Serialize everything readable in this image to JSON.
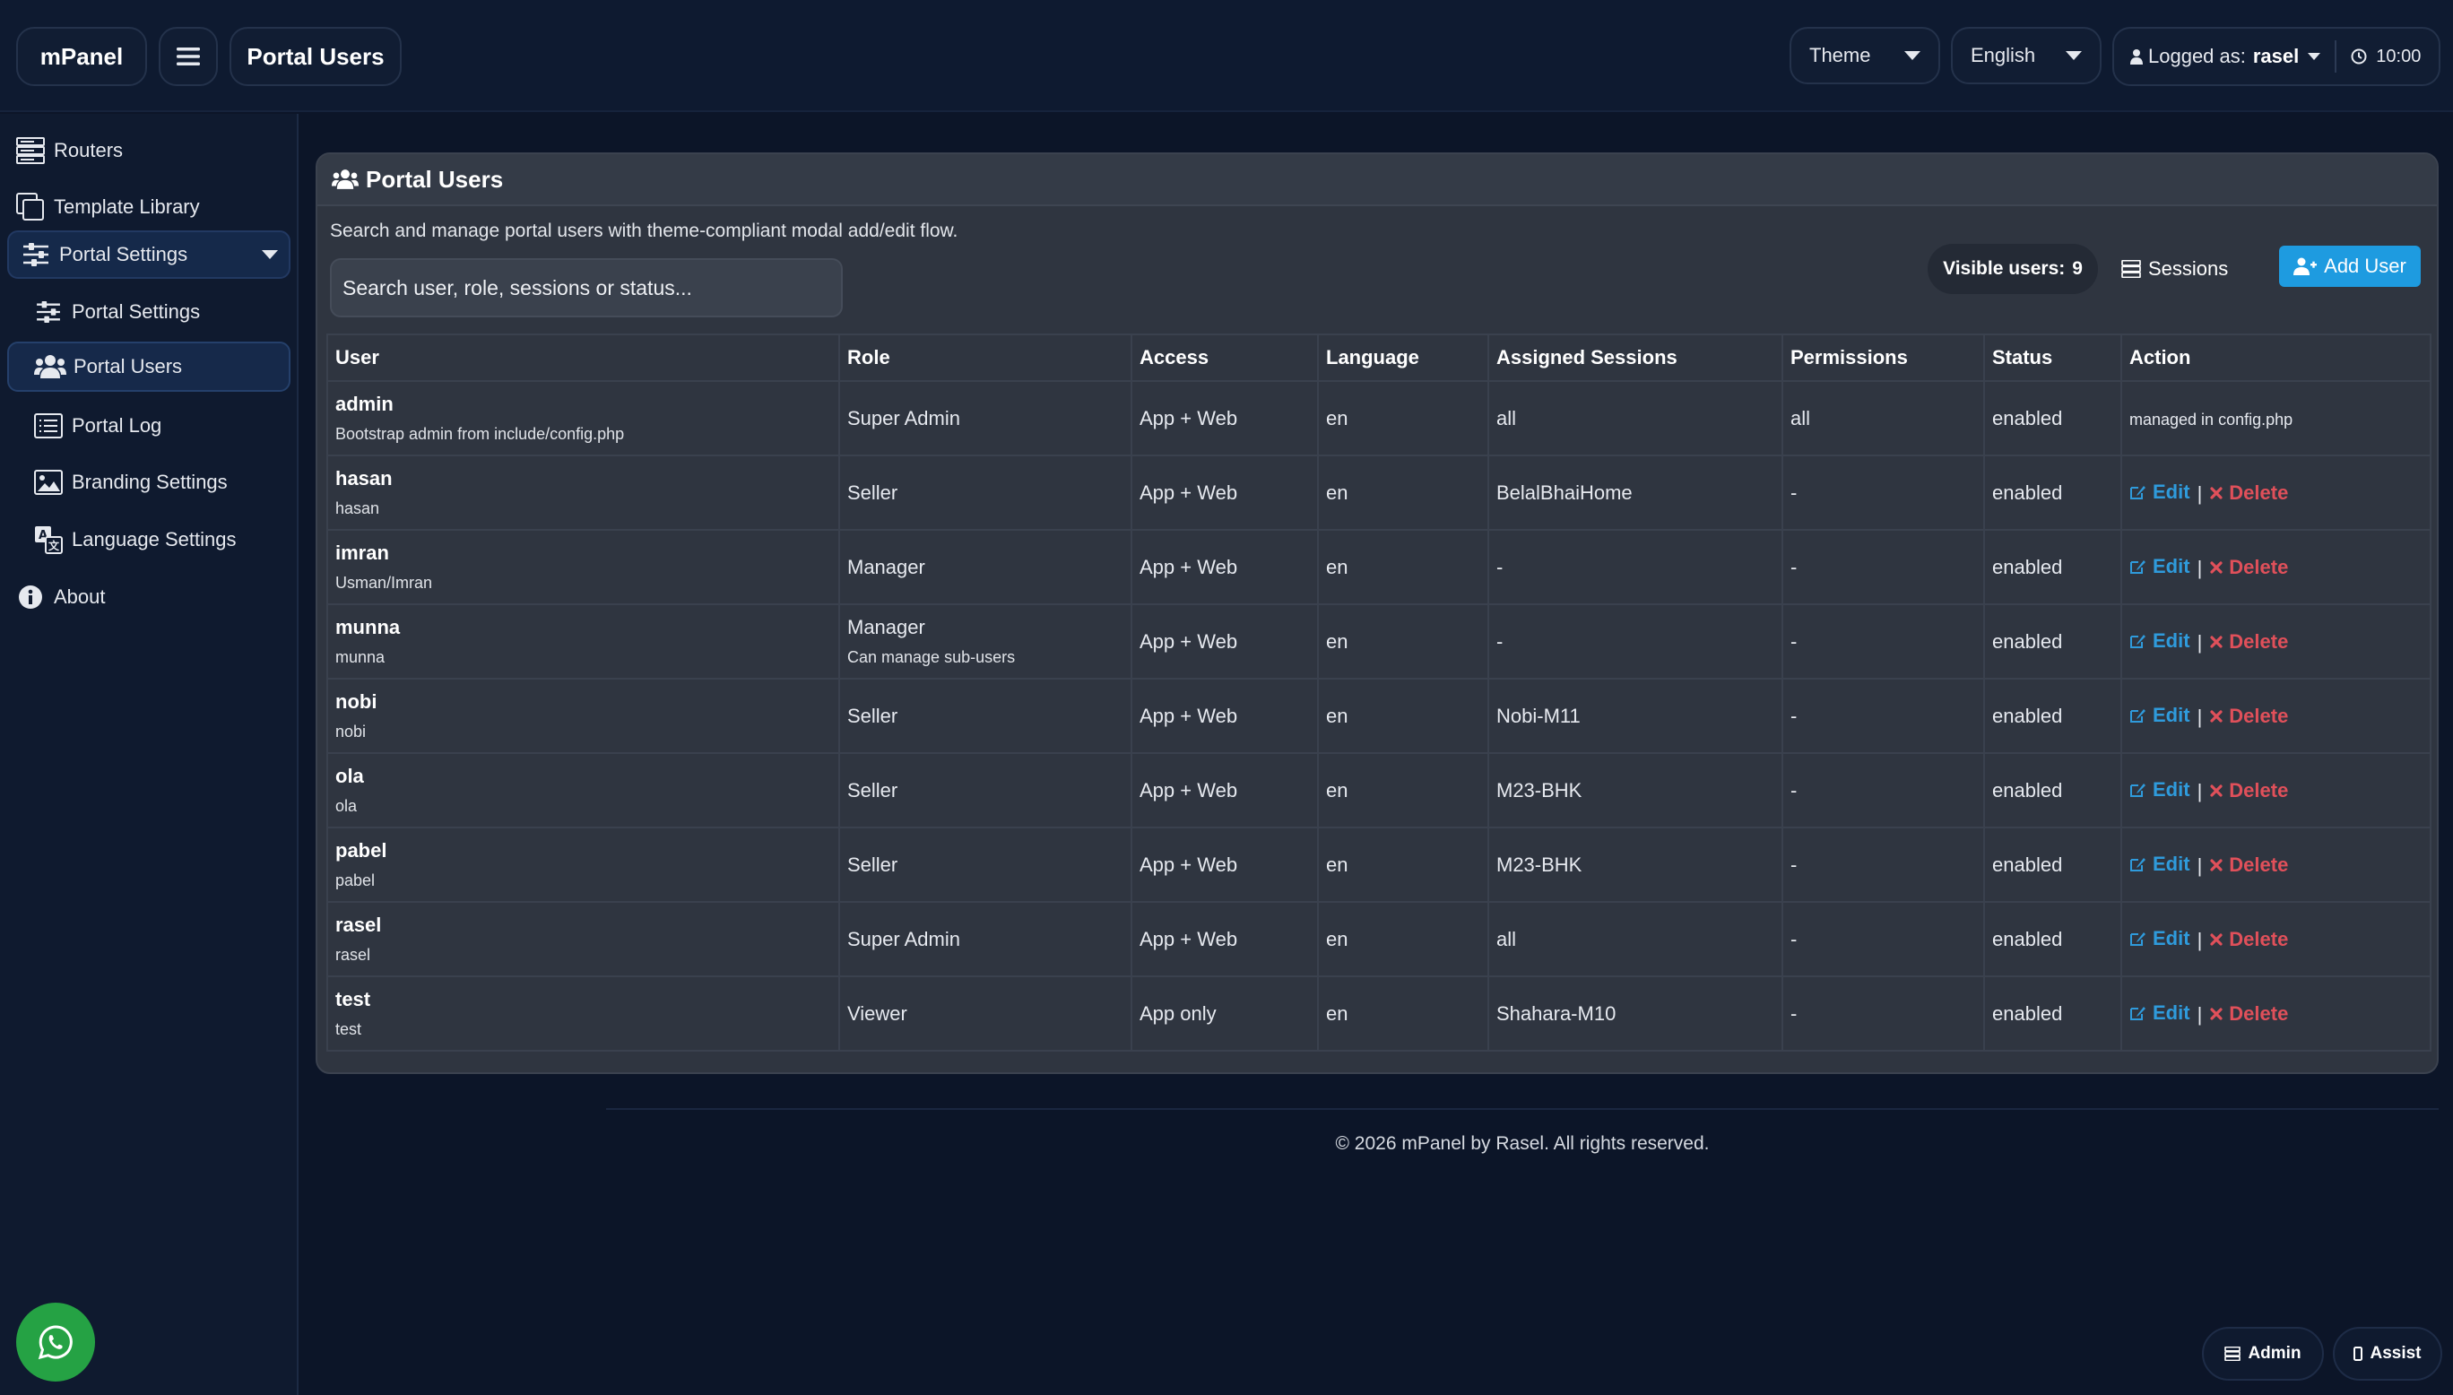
{
  "topbar": {
    "brand": "mPanel",
    "page_title": "Portal Users",
    "theme_label": "Theme",
    "language_label": "English",
    "logged_as_label": "Logged as:",
    "username": "rasel",
    "time": "10:00"
  },
  "sidebar": {
    "items": [
      {
        "label": "Routers",
        "icon": "server-icon"
      },
      {
        "label": "Template Library",
        "icon": "copy-icon"
      },
      {
        "label": "Portal Settings",
        "icon": "sliders-icon"
      },
      {
        "label": "Portal Settings",
        "icon": "sliders-icon"
      },
      {
        "label": "Portal Users",
        "icon": "users-icon"
      },
      {
        "label": "Portal Log",
        "icon": "list-icon"
      },
      {
        "label": "Branding Settings",
        "icon": "image-icon"
      },
      {
        "label": "Language Settings",
        "icon": "language-icon"
      },
      {
        "label": "About",
        "icon": "info-icon"
      }
    ]
  },
  "card": {
    "title": "Portal Users",
    "description": "Search and manage portal users with theme-compliant modal add/edit flow.",
    "search_placeholder": "Search user, role, sessions or status...",
    "visible_label": "Visible users:",
    "visible_count": "9",
    "sessions_label": "Sessions",
    "add_user_label": "Add User"
  },
  "table": {
    "headers": [
      "User",
      "Role",
      "Access",
      "Language",
      "Assigned Sessions",
      "Permissions",
      "Status",
      "Action"
    ],
    "edit_label": "Edit",
    "delete_label": "Delete",
    "separator": "|",
    "rows": [
      {
        "name": "admin",
        "sub": "Bootstrap admin from include/config.php",
        "role": "Super Admin",
        "role_note": "",
        "access": "App + Web",
        "language": "en",
        "sessions": "all",
        "permissions": "all",
        "status": "enabled",
        "action_note": "managed in config.php"
      },
      {
        "name": "hasan",
        "sub": "hasan",
        "role": "Seller",
        "role_note": "",
        "access": "App + Web",
        "language": "en",
        "sessions": "BelalBhaiHome",
        "permissions": "-",
        "status": "enabled",
        "action_note": ""
      },
      {
        "name": "imran",
        "sub": "Usman/Imran",
        "role": "Manager",
        "role_note": "",
        "access": "App + Web",
        "language": "en",
        "sessions": "-",
        "permissions": "-",
        "status": "enabled",
        "action_note": ""
      },
      {
        "name": "munna",
        "sub": "munna",
        "role": "Manager",
        "role_note": "Can manage sub-users",
        "access": "App + Web",
        "language": "en",
        "sessions": "-",
        "permissions": "-",
        "status": "enabled",
        "action_note": ""
      },
      {
        "name": "nobi",
        "sub": "nobi",
        "role": "Seller",
        "role_note": "",
        "access": "App + Web",
        "language": "en",
        "sessions": "Nobi-M11",
        "permissions": "-",
        "status": "enabled",
        "action_note": ""
      },
      {
        "name": "ola",
        "sub": "ola",
        "role": "Seller",
        "role_note": "",
        "access": "App + Web",
        "language": "en",
        "sessions": "M23-BHK",
        "permissions": "-",
        "status": "enabled",
        "action_note": ""
      },
      {
        "name": "pabel",
        "sub": "pabel",
        "role": "Seller",
        "role_note": "",
        "access": "App + Web",
        "language": "en",
        "sessions": "M23-BHK",
        "permissions": "-",
        "status": "enabled",
        "action_note": ""
      },
      {
        "name": "rasel",
        "sub": "rasel",
        "role": "Super Admin",
        "role_note": "",
        "access": "App + Web",
        "language": "en",
        "sessions": "all",
        "permissions": "-",
        "status": "enabled",
        "action_note": ""
      },
      {
        "name": "test",
        "sub": "test",
        "role": "Viewer",
        "role_note": "",
        "access": "App only",
        "language": "en",
        "sessions": "Shahara-M10",
        "permissions": "-",
        "status": "enabled",
        "action_note": ""
      }
    ]
  },
  "footer": {
    "text": "© 2026 mPanel by Rasel. All rights reserved."
  },
  "bottom_buttons": {
    "admin_label": "Admin",
    "assist_label": "Assist"
  },
  "colors": {
    "background": "#0c1528",
    "card": "#2f3540",
    "accent": "#1e9be0",
    "status_enabled": "#3fbf6a",
    "delete": "#e0505a",
    "whatsapp": "#25a244"
  }
}
